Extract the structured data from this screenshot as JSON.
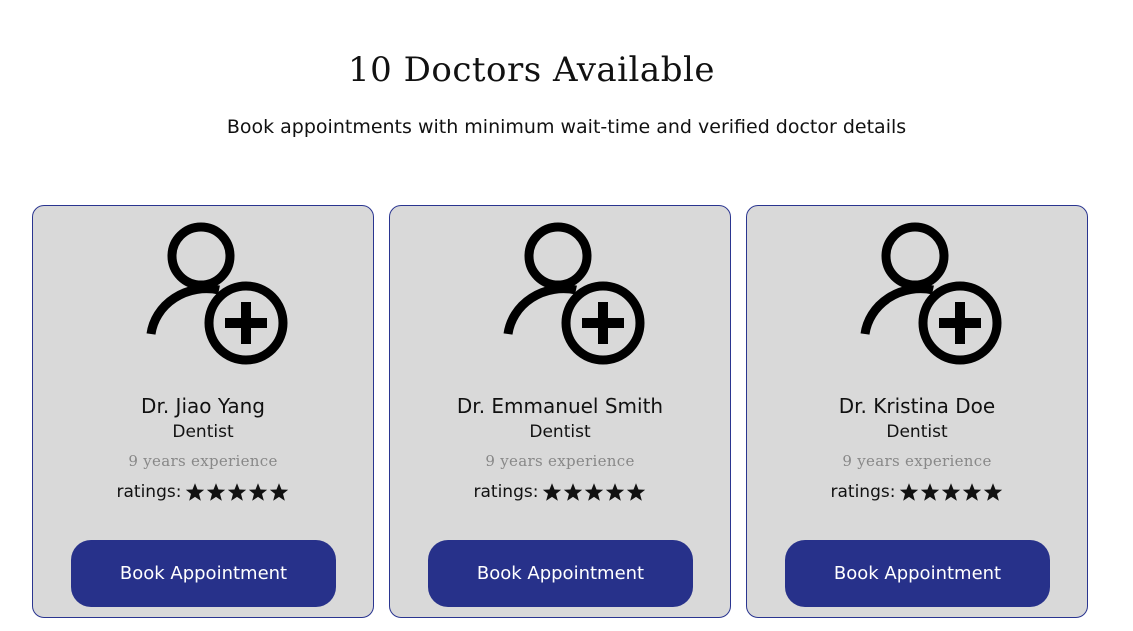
{
  "header": {
    "title": "10 Doctors Available",
    "subtitle": "Book appointments with minimum wait-time and verified doctor details"
  },
  "doctors": [
    {
      "name": "Dr. Jiao Yang",
      "specialty": "Dentist",
      "experience": "9 years experience",
      "ratings_label": "ratings:",
      "rating": 5,
      "button_label": "Book Appointment"
    },
    {
      "name": "Dr. Emmanuel Smith",
      "specialty": "Dentist",
      "experience": "9 years experience",
      "ratings_label": "ratings:",
      "rating": 5,
      "button_label": "Book Appointment"
    },
    {
      "name": "Dr. Kristina Doe",
      "specialty": "Dentist",
      "experience": "9 years experience",
      "ratings_label": "ratings:",
      "rating": 5,
      "button_label": "Book Appointment"
    }
  ],
  "icons": {
    "avatar": "user-plus-icon",
    "star": "star-icon"
  },
  "colors": {
    "card_background": "#d9d9d9",
    "card_border": "#2a3590",
    "button_background": "#27318a",
    "button_text": "#ffffff",
    "experience_text": "#888888"
  }
}
